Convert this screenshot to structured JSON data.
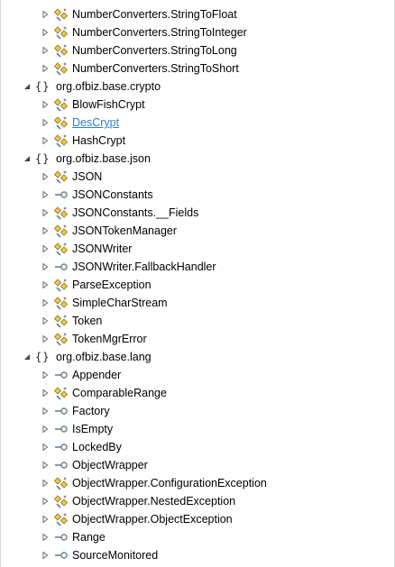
{
  "tree": [
    {
      "kind": "class",
      "expanded": false,
      "icon": "class-icon",
      "label": "NumberConverters.StringToFloat"
    },
    {
      "kind": "class",
      "expanded": false,
      "icon": "class-icon",
      "label": "NumberConverters.StringToInteger"
    },
    {
      "kind": "class",
      "expanded": false,
      "icon": "class-icon",
      "label": "NumberConverters.StringToLong"
    },
    {
      "kind": "class",
      "expanded": false,
      "icon": "class-icon",
      "label": "NumberConverters.StringToShort"
    },
    {
      "kind": "package",
      "expanded": true,
      "icon": "package-icon",
      "glyph": "{}",
      "label": "org.ofbiz.base.crypto"
    },
    {
      "kind": "class",
      "expanded": false,
      "icon": "class-icon",
      "label": "BlowFishCrypt"
    },
    {
      "kind": "class",
      "expanded": false,
      "icon": "class-icon",
      "label": "DesCrypt",
      "link": true
    },
    {
      "kind": "class",
      "expanded": false,
      "icon": "class-icon",
      "label": "HashCrypt"
    },
    {
      "kind": "package",
      "expanded": true,
      "icon": "package-icon",
      "glyph": "{}",
      "label": "org.ofbiz.base.json"
    },
    {
      "kind": "class",
      "expanded": false,
      "icon": "class-icon",
      "label": "JSON"
    },
    {
      "kind": "class",
      "expanded": false,
      "icon": "interface-icon",
      "label": "JSONConstants"
    },
    {
      "kind": "class",
      "expanded": false,
      "icon": "class-icon",
      "label": "JSONConstants.__Fields"
    },
    {
      "kind": "class",
      "expanded": false,
      "icon": "class-icon",
      "label": "JSONTokenManager"
    },
    {
      "kind": "class",
      "expanded": false,
      "icon": "class-icon",
      "label": "JSONWriter"
    },
    {
      "kind": "class",
      "expanded": false,
      "icon": "interface-icon",
      "label": "JSONWriter.FallbackHandler"
    },
    {
      "kind": "class",
      "expanded": false,
      "icon": "class-icon",
      "label": "ParseException"
    },
    {
      "kind": "class",
      "expanded": false,
      "icon": "class-icon",
      "label": "SimpleCharStream"
    },
    {
      "kind": "class",
      "expanded": false,
      "icon": "class-icon",
      "label": "Token"
    },
    {
      "kind": "class",
      "expanded": false,
      "icon": "class-icon",
      "label": "TokenMgrError"
    },
    {
      "kind": "package",
      "expanded": true,
      "icon": "package-icon",
      "glyph": "{}",
      "label": "org.ofbiz.base.lang"
    },
    {
      "kind": "class",
      "expanded": false,
      "icon": "interface-icon",
      "label": "Appender"
    },
    {
      "kind": "class",
      "expanded": false,
      "icon": "class-icon",
      "label": "ComparableRange"
    },
    {
      "kind": "class",
      "expanded": false,
      "icon": "interface-icon",
      "label": "Factory"
    },
    {
      "kind": "class",
      "expanded": false,
      "icon": "interface-icon",
      "label": "IsEmpty"
    },
    {
      "kind": "class",
      "expanded": false,
      "icon": "interface-icon",
      "label": "LockedBy"
    },
    {
      "kind": "class",
      "expanded": false,
      "icon": "interface-icon",
      "label": "ObjectWrapper"
    },
    {
      "kind": "class",
      "expanded": false,
      "icon": "class-icon",
      "label": "ObjectWrapper.ConfigurationException"
    },
    {
      "kind": "class",
      "expanded": false,
      "icon": "class-icon",
      "label": "ObjectWrapper.NestedException"
    },
    {
      "kind": "class",
      "expanded": false,
      "icon": "class-icon",
      "label": "ObjectWrapper.ObjectException"
    },
    {
      "kind": "class",
      "expanded": false,
      "icon": "interface-icon",
      "label": "Range"
    },
    {
      "kind": "class",
      "expanded": false,
      "icon": "interface-icon",
      "label": "SourceMonitored"
    }
  ],
  "colors": {
    "link": "#2f7fd6",
    "class_icon_fill": "#f2c94c",
    "class_icon_stroke": "#8a6d1a",
    "interface_icon": "#6a7d96",
    "arrow": "#6b6b6b"
  }
}
